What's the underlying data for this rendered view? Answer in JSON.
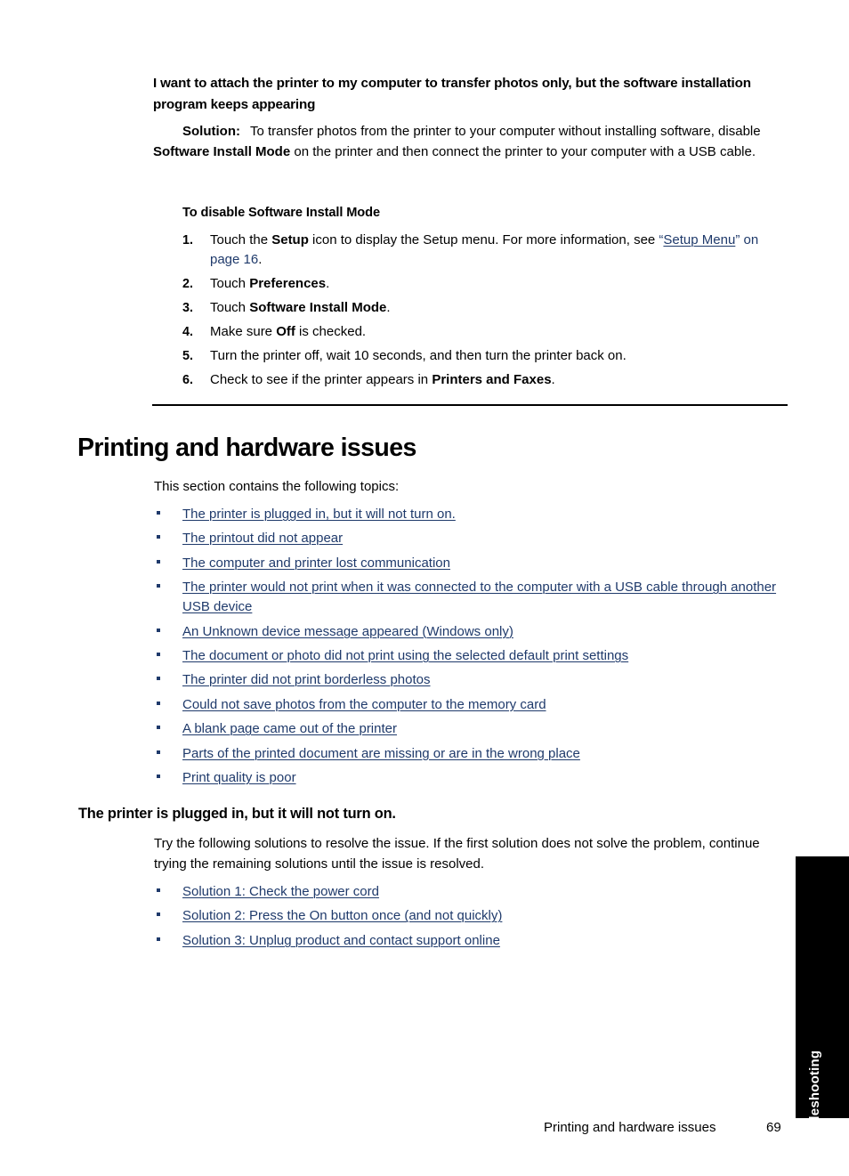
{
  "document": {
    "question_heading": "I want to attach the printer to my computer to transfer photos only, but the software installation program keeps appearing",
    "solution": {
      "label": "Solution:",
      "text_part1": "To transfer photos from the printer to your computer without installing software, disable ",
      "bold_term": "Software Install Mode",
      "text_part2": " on the printer and then connect the printer to your computer with a USB cable."
    },
    "procedure": {
      "title": "To disable Software Install Mode",
      "steps": [
        {
          "number": "1.",
          "pre": "Touch the ",
          "bold": "Setup",
          "post": " icon to display the Setup menu. For more information, see ",
          "xref_open_quote": "“",
          "xref_link": "Setup Menu",
          "xref_tail": "” on page 16",
          "end": "."
        },
        {
          "number": "2.",
          "pre": "Touch ",
          "bold": "Preferences",
          "post": "."
        },
        {
          "number": "3.",
          "pre": "Touch ",
          "bold": "Software Install Mode",
          "post": "."
        },
        {
          "number": "4.",
          "pre": "Make sure ",
          "bold": "Off",
          "post": " is checked."
        },
        {
          "number": "5.",
          "pre": "Turn the printer off, wait 10 seconds, and then turn the printer back on.",
          "bold": "",
          "post": ""
        },
        {
          "number": "6.",
          "pre": "Check to see if the printer appears in ",
          "bold": "Printers and Faxes",
          "post": "."
        }
      ]
    },
    "section": {
      "title": "Printing and hardware issues",
      "intro": "This section contains the following topics:",
      "topics": [
        "The printer is plugged in, but it will not turn on.",
        "The printout did not appear",
        "The computer and printer lost communication",
        "The printer would not print when it was connected to the computer with a USB cable through another USB device",
        "An Unknown device message appeared (Windows only)",
        "The document or photo did not print using the selected default print settings",
        "The printer did not print borderless photos",
        "Could not save photos from the computer to the memory card",
        "A blank page came out of the printer",
        "Parts of the printed document are missing or are in the wrong place",
        "Print quality is poor"
      ]
    },
    "subsection": {
      "title": "The printer is plugged in, but it will not turn on.",
      "paragraph": "Try the following solutions to resolve the issue. If the first solution does not solve the problem, continue trying the remaining solutions until the issue is resolved.",
      "solutions": [
        "Solution 1: Check the power cord",
        "Solution 2: Press the On button once (and not quickly)",
        "Solution 3: Unplug product and contact support online"
      ]
    },
    "thumb_tab": {
      "label": "Troubleshooting"
    },
    "footer": {
      "section_name": "Printing and hardware issues",
      "page_number": "69"
    },
    "colors": {
      "link": "#1f3a6b",
      "text": "#000000",
      "tab_background": "#000000",
      "tab_text": "#ffffff"
    }
  }
}
